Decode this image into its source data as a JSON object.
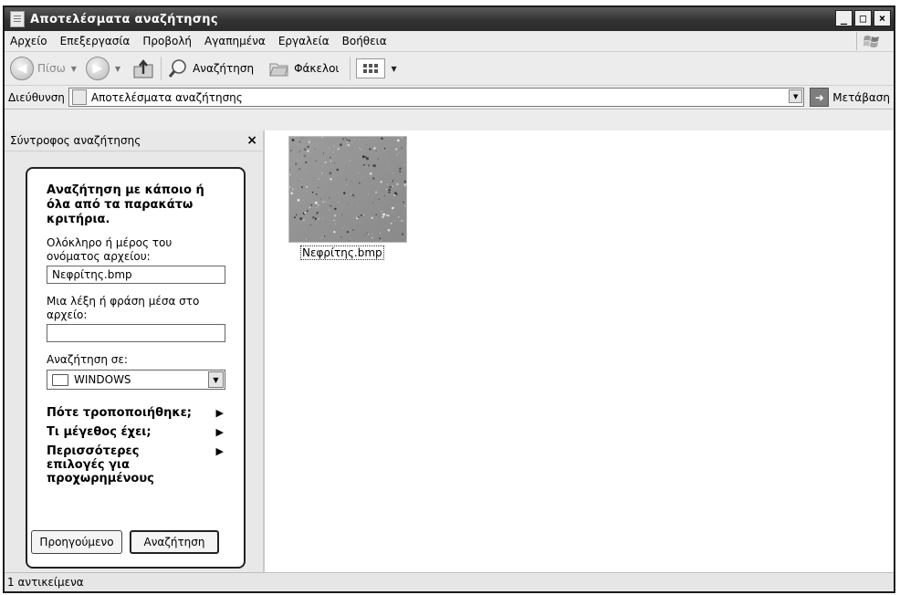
{
  "window": {
    "title": "Αποτελέσματα αναζήτησης",
    "buttons": {
      "minimize": "_",
      "maximize": "□",
      "close": "×"
    }
  },
  "menubar": {
    "items": [
      "Αρχείο",
      "Επεξεργασία",
      "Προβολή",
      "Αγαπημένα",
      "Εργαλεία",
      "Βοήθεια"
    ]
  },
  "toolbar": {
    "back_label": "Πίσω",
    "search_label": "Αναζήτηση",
    "folders_label": "Φάκελοι"
  },
  "addressbar": {
    "label": "Διεύθυνση",
    "value": "Αποτελέσματα αναζήτησης",
    "go_label": "Μετάβαση"
  },
  "search_panel": {
    "title": "Σύντροφος αναζήτησης",
    "close": "×",
    "heading": "Αναζήτηση με κάποιο ή όλα από τα παρακάτω κριτήρια.",
    "filename_label": "Ολόκληρο ή μέρος του ονόματος αρχείου:",
    "filename_value": "Νεφρίτης.bmp",
    "phrase_label": "Μια λέξη ή φράση μέσα στο αρχείο:",
    "phrase_value": "",
    "lookin_label": "Αναζήτηση σε:",
    "lookin_value": "WINDOWS",
    "options": [
      {
        "label": "Πότε τροποποιήθηκε;"
      },
      {
        "label": "Τι μέγεθος έχει;"
      },
      {
        "label": "Περισσότερες επιλογές για προχωρημένους"
      }
    ],
    "back_button": "Προηγούμενο",
    "search_button": "Αναζήτηση"
  },
  "results": {
    "files": [
      {
        "name": "Νεφρίτης.bmp"
      }
    ]
  },
  "statusbar": {
    "text": "1 αντικείμενα"
  }
}
